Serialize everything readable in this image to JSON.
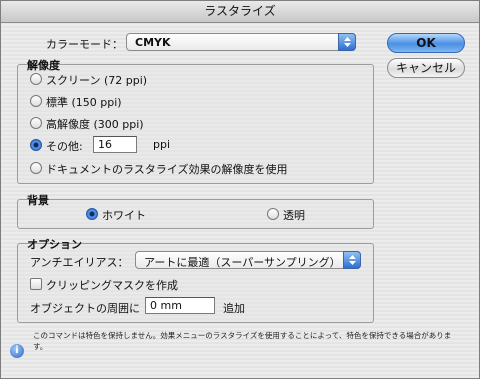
{
  "window": {
    "title": "ラスタライズ"
  },
  "color_mode": {
    "label": "カラーモード：",
    "value": "CMYK"
  },
  "buttons": {
    "ok": "OK",
    "cancel": "キャンセル"
  },
  "resolution": {
    "legend": "解像度",
    "options": [
      {
        "label": "スクリーン (72 ppi)",
        "selected": false
      },
      {
        "label": "標準 (150 ppi)",
        "selected": false
      },
      {
        "label": "高解像度 (300 ppi)",
        "selected": false
      },
      {
        "label": "その他:",
        "selected": true
      },
      {
        "label": "ドキュメントのラスタライズ効果の解像度を使用",
        "selected": false
      }
    ],
    "other_value": "16",
    "unit": "ppi"
  },
  "background": {
    "legend": "背景",
    "white": "ホワイト",
    "transparent": "透明",
    "selected": "white"
  },
  "options": {
    "legend": "オプション",
    "antialias_label": "アンチエイリアス：",
    "antialias_value": "アートに最適（スーパーサンプリング）",
    "clipping_mask": "クリッピングマスクを作成",
    "clipping_checked": false,
    "surround_label": "オブジェクトの周囲に",
    "surround_value": "0 mm",
    "surround_suffix": "追加"
  },
  "note": "このコマンドは特色を保持しません。効果メニューのラスタライズを使用することによって、特色を保持できる場合があります。"
}
